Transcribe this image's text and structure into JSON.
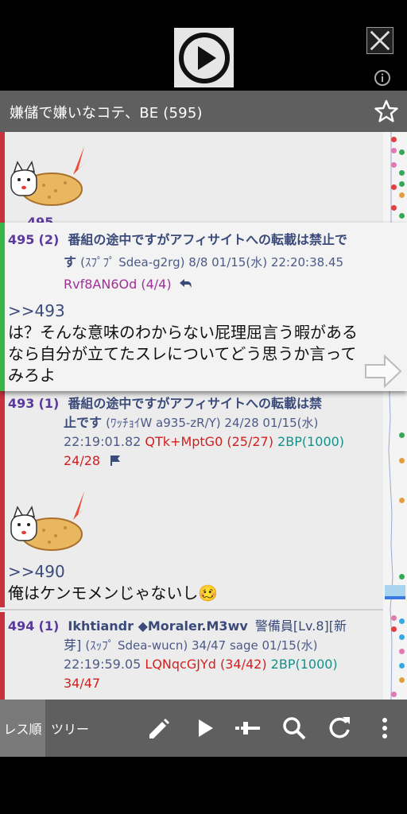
{
  "thread_title": "嫌儲で嫌いなコテ、BE (595)",
  "hidden_number": "495",
  "popup_post": {
    "number": "495",
    "reply_count": "(2)",
    "name_line1": "番組の途中ですがアフィサイトへの転載は禁止で",
    "name_line2_a": "す",
    "name_line2_b": "(ｽﾌﾟﾌﾟ Sdea-g2rg) 8/8  01/15(水) 22:20:38.45",
    "id": "Rvf8AN6Od (4/4)",
    "anchor": ">>493",
    "body": [
      "は？そんな意味のわからない屁理屈言う暇がある",
      "なら自分が立てたスレについてどう思うか言って",
      "みろよ"
    ]
  },
  "post493": {
    "number": "493",
    "reply_count": "(1)",
    "name_line1": "番組の途中ですがアフィサイトへの転載は禁",
    "name_line2_a": "止です",
    "name_line2_b": "(ﾜｯﾁｮｲW a935-zR/Y) 24/28  01/15(水)",
    "time": "22:19:01.82",
    "id": "QTk+MptG0 (25/27)",
    "be": "2BP(1000)",
    "count": "24/28",
    "anchor": ">>490",
    "body": "俺はケンモメンじゃないし🥴"
  },
  "post494": {
    "number": "494",
    "reply_count": "(1)",
    "name": "Ikhtiandr ◆Moraler.M3wv",
    "rank": "警備員[Lv.8][新",
    "name_line2_a": "芽]",
    "name_line2_b": "(ｽｯﾌﾟ Sdea-wucn) 34/47 sage 01/15(水)",
    "time": "22:19:59.05",
    "id": "LQNqcGJYd (34/42)",
    "be": "2BP(1000)",
    "count": "34/47"
  },
  "toolbar": {
    "tab_order": "レス順",
    "tab_tree": "ツリー"
  },
  "icons": [
    "play-icon",
    "close-icon",
    "info-icon",
    "star-icon",
    "reply-icon",
    "flag-icon",
    "pencil-icon",
    "play-arrow-icon",
    "slider-icon",
    "search-icon",
    "refresh-icon",
    "more-vert-icon",
    "next-arrow-icon"
  ],
  "colors": {
    "titlebar": "#5f5f5f",
    "thread_bg": "#ececec",
    "red_bar": "#c8323c",
    "green_bar": "#3ab54a",
    "post_number": "#5a3a9a",
    "id_red": "#d41e1e",
    "be_teal": "#14908a"
  }
}
